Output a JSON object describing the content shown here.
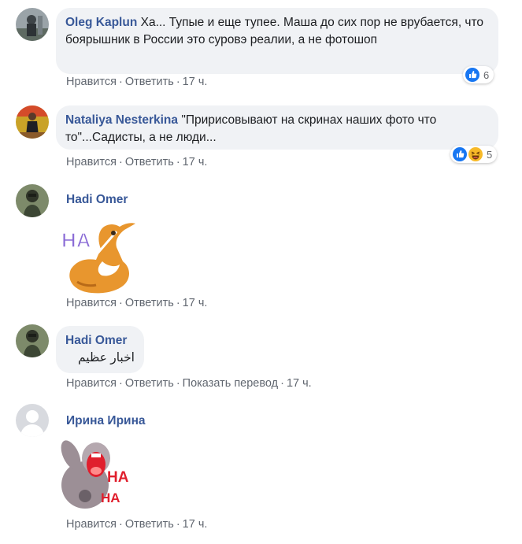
{
  "comments": [
    {
      "author": "Oleg Kaplun",
      "text": "Ха... Тупые и еще тупее. Маша до сих пор не врубается, что боярышник в России это суровэ реалии, а не фотошоп",
      "reaction_count": "6",
      "reaction_icons": [
        "like-icon"
      ],
      "actions": [
        "Нравится",
        "Ответить"
      ],
      "time": "17 ч."
    },
    {
      "author": "Nataliya Nesterkina",
      "text": "\"Пририсовывают на скринах наших фото что то\"...Садисты, а не люди...",
      "reaction_count": "5",
      "reaction_icons": [
        "like-icon",
        "haha-icon"
      ],
      "actions": [
        "Нравится",
        "Ответить"
      ],
      "time": "17 ч."
    },
    {
      "author": "Hadi Omer",
      "sticker": "laughing-dog-sticker",
      "sticker_text": "HA",
      "actions": [
        "Нравится",
        "Ответить"
      ],
      "time": "17 ч."
    },
    {
      "author": "Hadi Omer",
      "text": "اخبار عظيم",
      "actions": [
        "Нравится",
        "Ответить",
        "Показать перевод"
      ],
      "time": "17 ч."
    },
    {
      "author": "Ирина Ирина",
      "sticker": "laughing-bunny-sticker",
      "sticker_text": [
        "HA",
        "HA"
      ],
      "actions": [
        "Нравится",
        "Ответить"
      ],
      "time": "17 ч."
    }
  ],
  "colors": {
    "author": "#385898",
    "bubble": "#f0f2f5",
    "meta": "#616770",
    "like": "#1877f2",
    "haha": "#f7b928"
  }
}
